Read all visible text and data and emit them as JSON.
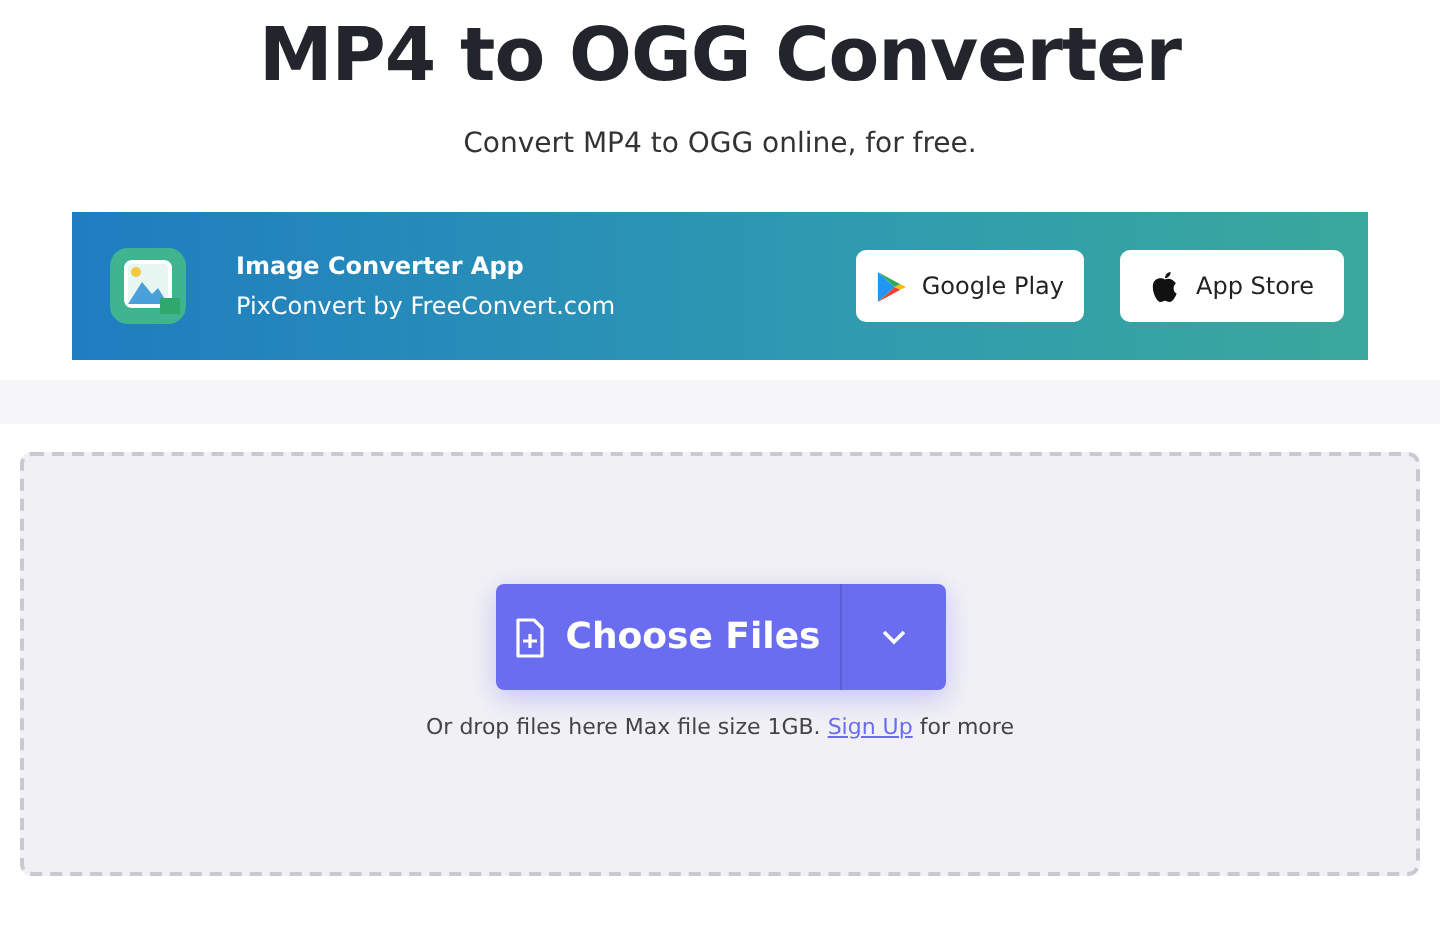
{
  "title": "MP4 to OGG Converter",
  "subtitle": "Convert MP4 to OGG online, for free.",
  "banner": {
    "app_name": "Image Converter App",
    "app_by": "PixConvert by FreeConvert.com",
    "stores": [
      {
        "kind": "google",
        "label": "Google Play"
      },
      {
        "kind": "apple",
        "label": "App Store"
      }
    ]
  },
  "upload": {
    "button": "Choose Files",
    "hint_before": "Or drop files here Max file size 1GB.",
    "hint_link": "Sign Up",
    "hint_after": "for more"
  }
}
